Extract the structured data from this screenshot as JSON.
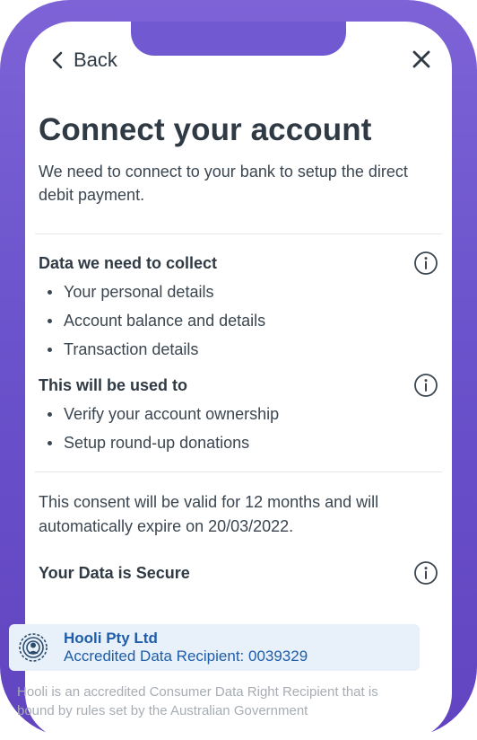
{
  "header": {
    "back_label": "Back",
    "back_icon": "chevron-left-icon",
    "close_icon": "close-icon"
  },
  "title": "Connect your account",
  "lead": "We need to connect to your bank to setup the direct debit payment.",
  "sections": [
    {
      "title": "Data we need to collect",
      "icon": "info-icon",
      "items": [
        "Your personal details",
        "Account balance and details",
        "Transaction details"
      ]
    },
    {
      "title": "This will be used to",
      "icon": "info-icon",
      "items": [
        "Verify your account ownership",
        "Setup round-up donations"
      ]
    }
  ],
  "consent_text": "This consent will be valid for 12 months and will automatically expire on 20/03/2022.",
  "secure": {
    "title": "Your Data is Secure",
    "icon": "info-icon"
  },
  "recipient": {
    "name": "Hooli Pty Ltd",
    "id_text": "Accredited Data Recipient: 0039329",
    "logo": "data-recipient-logo-icon"
  },
  "footnote": "Hooli is an accredited Consumer Data Right Recipient that is bound by rules set by the Australian Government",
  "colors": {
    "frame": "#6a53cc",
    "text": "#2f3a44",
    "link_blue": "#1f5da8",
    "recipient_bg": "#e8f1fa"
  }
}
